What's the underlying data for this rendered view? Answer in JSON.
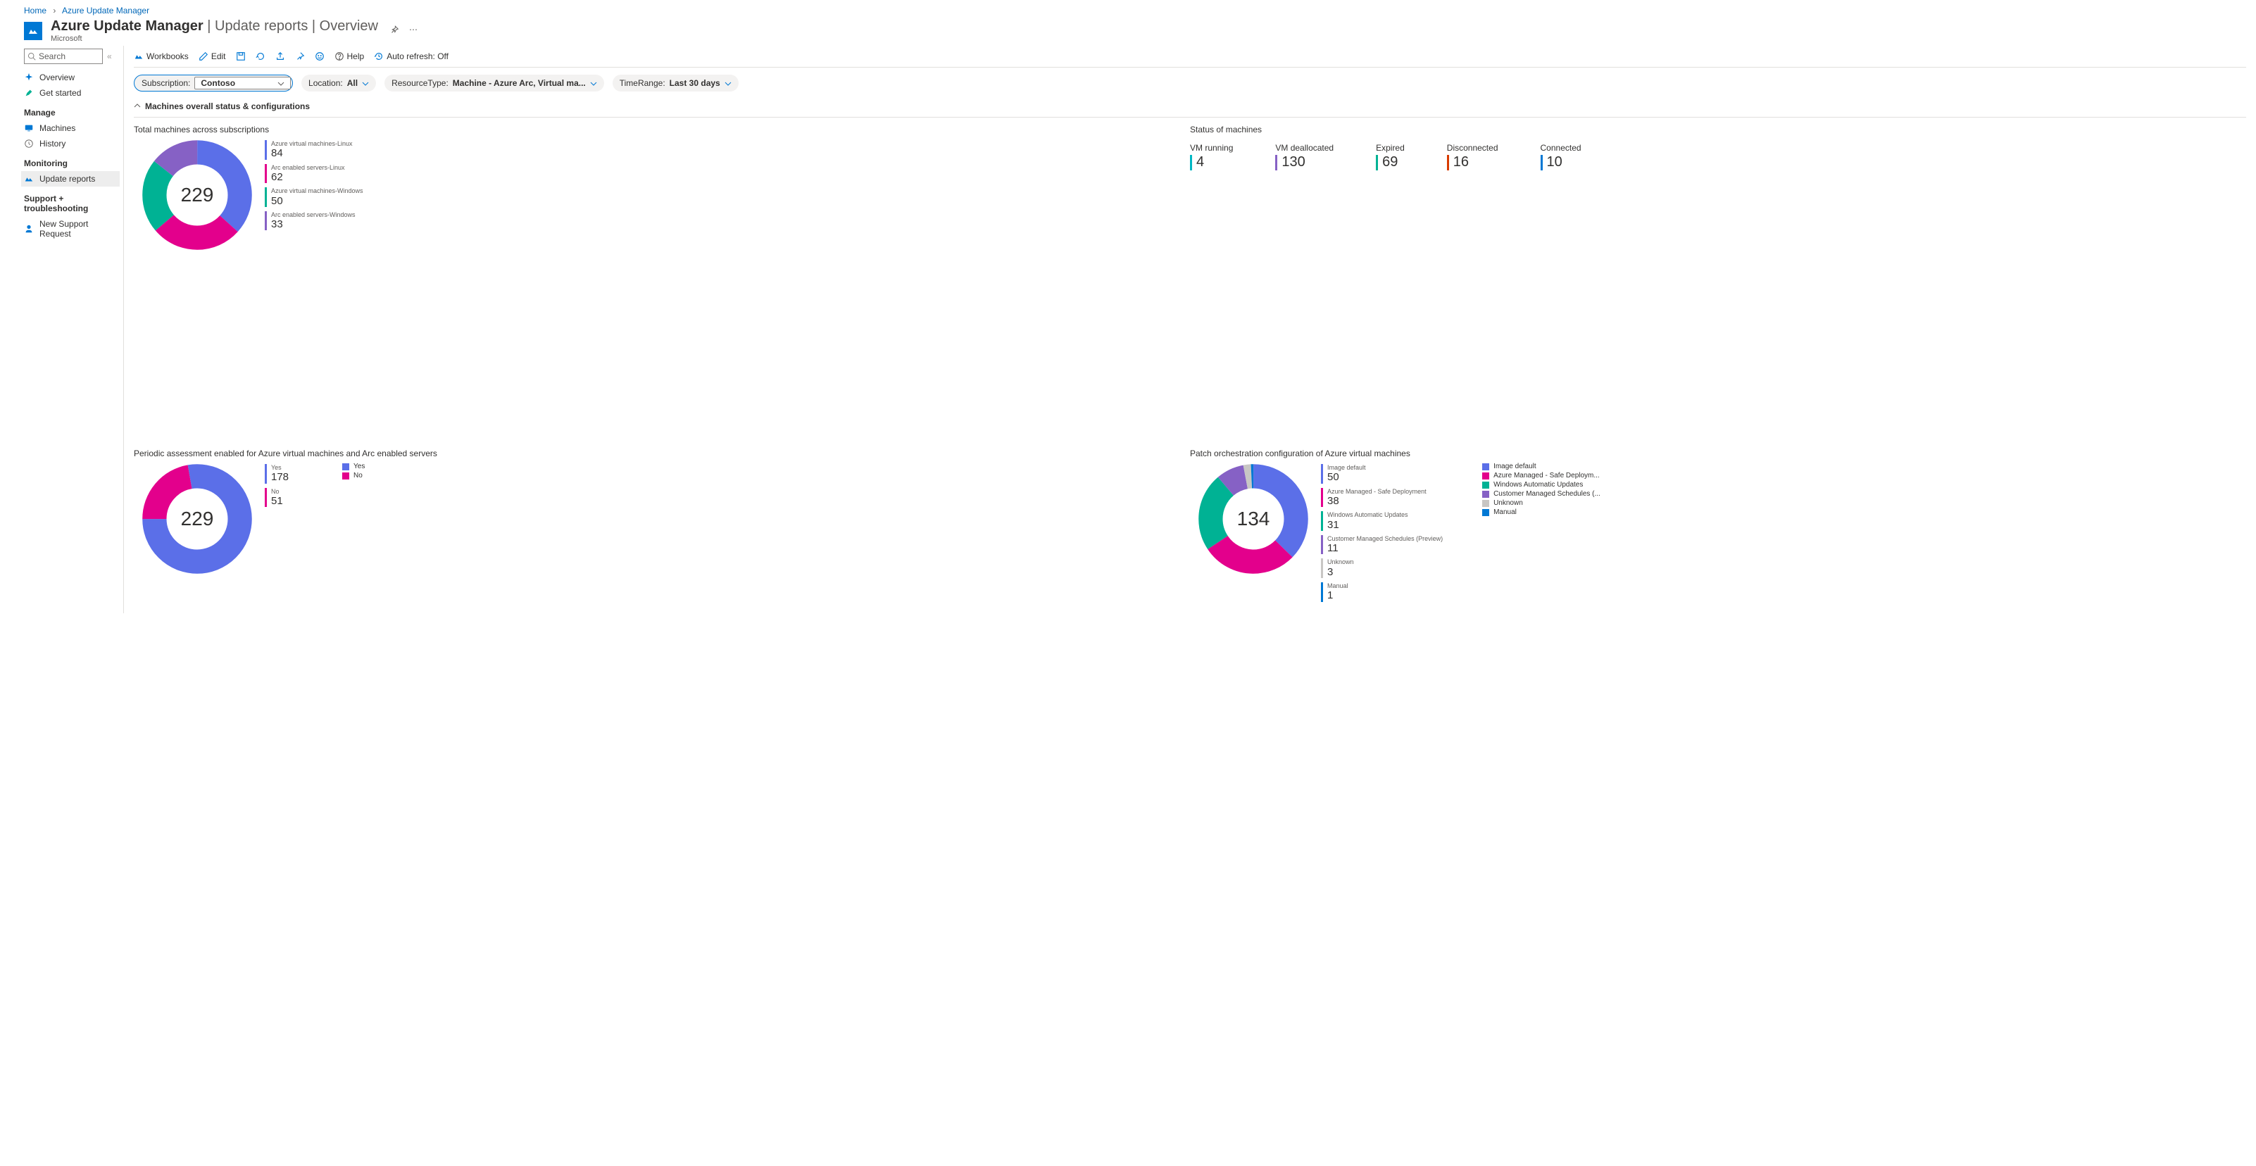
{
  "breadcrumb": {
    "home": "Home",
    "current": "Azure Update Manager"
  },
  "header": {
    "title": "Azure Update Manager",
    "subtitle_path": " | Update reports | Overview",
    "publisher": "Microsoft"
  },
  "sidebar": {
    "search_placeholder": "Search",
    "items": [
      {
        "label": "Overview",
        "icon": "sparkle"
      },
      {
        "label": "Get started",
        "icon": "rocket"
      }
    ],
    "sections": [
      {
        "label": "Manage",
        "items": [
          {
            "label": "Machines",
            "icon": "monitor"
          },
          {
            "label": "History",
            "icon": "clock"
          }
        ]
      },
      {
        "label": "Monitoring",
        "items": [
          {
            "label": "Update reports",
            "icon": "chart",
            "selected": true
          }
        ]
      },
      {
        "label": "Support + troubleshooting",
        "items": [
          {
            "label": "New Support Request",
            "icon": "person"
          }
        ]
      }
    ]
  },
  "toolbar": {
    "workbooks": "Workbooks",
    "edit": "Edit",
    "help": "Help",
    "autorefresh": "Auto refresh: Off"
  },
  "filters": {
    "subscription_label": "Subscription:",
    "subscription_value": "Contoso",
    "location_label": "Location:",
    "location_value": "All",
    "resource_label": "ResourceType:",
    "resource_value": "Machine - Azure Arc, Virtual ma...",
    "time_label": "TimeRange:",
    "time_value": "Last 30 days"
  },
  "section": {
    "title": "Machines overall status & configurations"
  },
  "card1": {
    "title": "Total machines across subscriptions",
    "total": "229",
    "items": [
      {
        "label": "Azure virtual machines-Linux",
        "value": "84",
        "color": "c-blue"
      },
      {
        "label": "Arc enabled servers-Linux",
        "value": "62",
        "color": "c-pink"
      },
      {
        "label": "Azure virtual machines-Windows",
        "value": "50",
        "color": "c-teal"
      },
      {
        "label": "Arc enabled servers-Windows",
        "value": "33",
        "color": "c-purple"
      }
    ]
  },
  "card2": {
    "title": "Status of machines",
    "tiles": [
      {
        "label": "VM running",
        "value": "4",
        "color": "c-cyan"
      },
      {
        "label": "VM deallocated",
        "value": "130",
        "color": "c-purple"
      },
      {
        "label": "Expired",
        "value": "69",
        "color": "c-teal"
      },
      {
        "label": "Disconnected",
        "value": "16",
        "color": "c-orange"
      },
      {
        "label": "Connected",
        "value": "10",
        "color": "c-blue2"
      }
    ]
  },
  "card3": {
    "title": "Periodic assessment enabled for Azure virtual machines and Arc enabled servers",
    "total": "229",
    "items": [
      {
        "label": "Yes",
        "value": "178",
        "color": "c-blue"
      },
      {
        "label": "No",
        "value": "51",
        "color": "c-pink"
      }
    ],
    "legend": [
      {
        "label": "Yes",
        "color": "c-blue"
      },
      {
        "label": "No",
        "color": "c-pink"
      }
    ]
  },
  "card4": {
    "title": "Patch orchestration configuration of Azure virtual machines",
    "total": "134",
    "items": [
      {
        "label": "Image default",
        "value": "50",
        "color": "c-blue"
      },
      {
        "label": "Azure Managed - Safe Deployment",
        "value": "38",
        "color": "c-pink"
      },
      {
        "label": "Windows Automatic Updates",
        "value": "31",
        "color": "c-teal"
      },
      {
        "label": "Customer Managed Schedules (Preview)",
        "value": "11",
        "color": "c-purple"
      },
      {
        "label": "Unknown",
        "value": "3",
        "color": "c-grey"
      },
      {
        "label": "Manual",
        "value": "1",
        "color": "c-blue2"
      }
    ],
    "legend": [
      {
        "label": "Image default",
        "color": "c-blue"
      },
      {
        "label": "Azure Managed - Safe Deploym...",
        "color": "c-pink"
      },
      {
        "label": "Windows Automatic Updates",
        "color": "c-teal"
      },
      {
        "label": "Customer Managed Schedules (...",
        "color": "c-purple"
      },
      {
        "label": "Unknown",
        "color": "c-grey"
      },
      {
        "label": "Manual",
        "color": "c-blue2"
      }
    ]
  },
  "chart_data": [
    {
      "type": "pie",
      "title": "Total machines across subscriptions",
      "categories": [
        "Azure virtual machines-Linux",
        "Arc enabled servers-Linux",
        "Azure virtual machines-Windows",
        "Arc enabled servers-Windows"
      ],
      "values": [
        84,
        62,
        50,
        33
      ],
      "total": 229
    },
    {
      "type": "table",
      "title": "Status of machines",
      "categories": [
        "VM running",
        "VM deallocated",
        "Expired",
        "Disconnected",
        "Connected"
      ],
      "values": [
        4,
        130,
        69,
        16,
        10
      ]
    },
    {
      "type": "pie",
      "title": "Periodic assessment enabled for Azure virtual machines and Arc enabled servers",
      "categories": [
        "Yes",
        "No"
      ],
      "values": [
        178,
        51
      ],
      "total": 229
    },
    {
      "type": "pie",
      "title": "Patch orchestration configuration of Azure virtual machines",
      "categories": [
        "Image default",
        "Azure Managed - Safe Deployment",
        "Windows Automatic Updates",
        "Customer Managed Schedules (Preview)",
        "Unknown",
        "Manual"
      ],
      "values": [
        50,
        38,
        31,
        11,
        3,
        1
      ],
      "total": 134
    }
  ]
}
